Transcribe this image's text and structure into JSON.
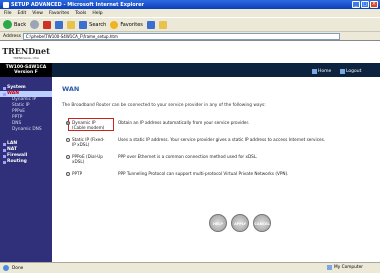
{
  "window": {
    "title": "SETUP ADVANCED - Microsoft Internet Explorer"
  },
  "menu": [
    "File",
    "Edit",
    "View",
    "Favorites",
    "Tools",
    "Help"
  ],
  "toolbar": {
    "back": "Back",
    "search": "Search",
    "favorites": "Favorites"
  },
  "address": {
    "label": "Address",
    "value": "C:\\phebe\\TW100-S4W1CA_F\\frame_setup.htm"
  },
  "brand": {
    "logo": "TRENDnet",
    "tagline": "TRENDware, USA",
    "model_line1": "TW100-S4W1CA",
    "model_line2": "Version F"
  },
  "header": {
    "home": "Home",
    "logout": "Logout"
  },
  "nav": {
    "items": [
      {
        "label": "System",
        "active": false
      },
      {
        "label": "WAN",
        "active": true
      }
    ],
    "subitems": [
      "Dynamic IP",
      "Static IP",
      "PPPoE",
      "PPTP",
      "DNS",
      "Dynamic DNS"
    ],
    "items_lower": [
      "LAN",
      "NAT",
      "Firewall",
      "Routing"
    ]
  },
  "main": {
    "title": "WAN",
    "intro": "The Broadband Router can be connected to your service provider in any of the following ways:",
    "options": [
      {
        "label": "Dynamic IP (Cable modem)",
        "desc": "Obtain an IP address automatically from your service provider.",
        "selected": true
      },
      {
        "label": "Static IP (Fixed-IP xDSL)",
        "desc": "Uses a static IP address. Your service provider gives a static IP address to access Internet services.",
        "selected": false
      },
      {
        "label": "PPPoE (Dial-Up xDSL)",
        "desc": "PPP over Ethernet is a common connection method used for xDSL.",
        "selected": false
      },
      {
        "label": "PPTP",
        "desc": "PPP Tunneling Protocol can support multi-protocol Virtual Private Networks (VPN).",
        "selected": false
      }
    ],
    "actions": [
      "HELP",
      "APPLY",
      "CANCEL"
    ]
  },
  "status": {
    "left": "Done",
    "zone": "My Computer"
  }
}
